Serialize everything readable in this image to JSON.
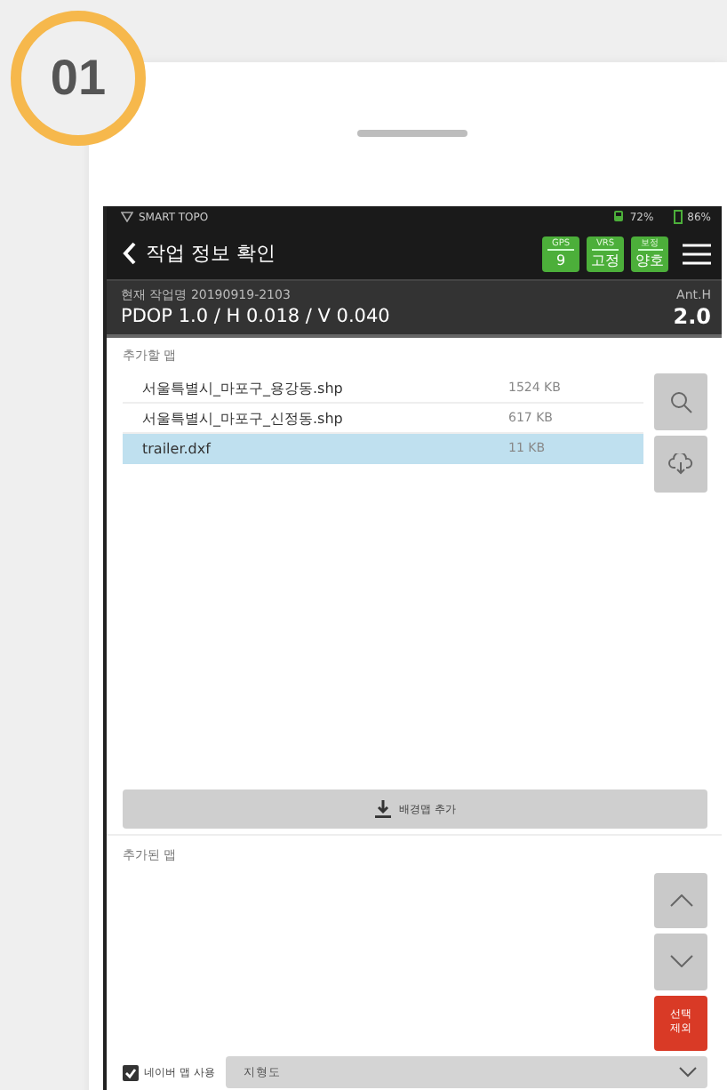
{
  "step_badge": "01",
  "status_bar": {
    "app_name": "SMART TOPO",
    "signal": "72%",
    "battery": "86%"
  },
  "title_bar": {
    "title": "작업 정보 확인",
    "indicators": [
      {
        "label": "GPS",
        "value": "9"
      },
      {
        "label": "VRS",
        "value": "고정"
      },
      {
        "label": "보정",
        "value": "양호"
      }
    ]
  },
  "info": {
    "job_name": "현재 작업명 20190919-2103",
    "precision": "PDOP 1.0 / H 0.018 / V 0.040",
    "ant_label": "Ant.H",
    "ant_value": "2.0"
  },
  "maps_to_add": {
    "heading": "추가할 맵",
    "files": [
      {
        "name": "서울특별시_마포구_용강동.shp",
        "size": "1524 KB",
        "selected": false
      },
      {
        "name": "서울특별시_마포구_신정동.shp",
        "size": "617 KB",
        "selected": false
      },
      {
        "name": "trailer.dxf",
        "size": "11 KB",
        "selected": true
      }
    ]
  },
  "add_background_button": "배경맵 추가",
  "added_maps": {
    "heading": "추가된 맵",
    "remove_button": "선택\n제외"
  },
  "naver_map": {
    "label": "네이버 맵 사용",
    "checked": true
  },
  "map_type_dropdown": {
    "value": "지형도"
  }
}
